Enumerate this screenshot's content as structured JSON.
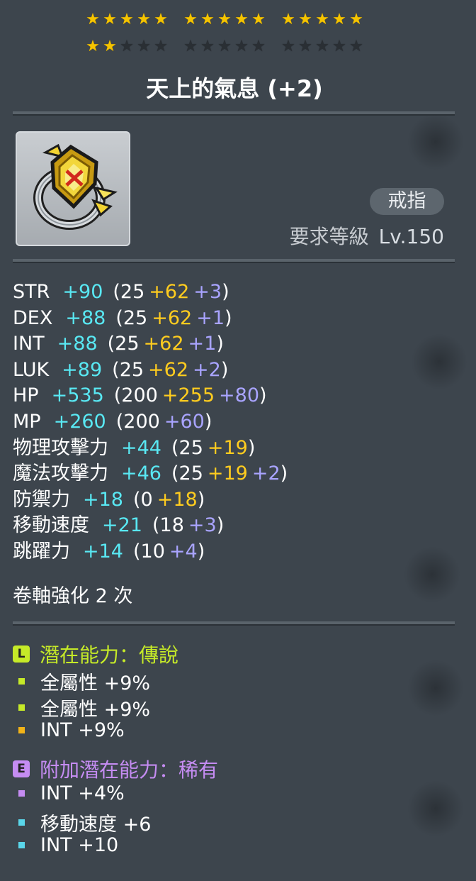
{
  "stars": {
    "filled": 17,
    "total": 30,
    "group_size": 5,
    "row1_groups": 3,
    "row2_groups": 3,
    "on_color": "#f5c400",
    "off_color": "#2a2f34"
  },
  "item": {
    "name": "天上的氣息 (+2)",
    "category": "戒指",
    "req_level_label": "要求等級",
    "req_level_value": "Lv.150",
    "icon": "gold-ring-icon"
  },
  "stats": [
    {
      "name": "STR",
      "total": "+90",
      "open": "(25",
      "parts": [
        {
          "v": "+62",
          "c": "yellow"
        },
        {
          "v": "+3",
          "c": "purple"
        }
      ],
      "close": ")"
    },
    {
      "name": "DEX",
      "total": "+88",
      "open": "(25",
      "parts": [
        {
          "v": "+62",
          "c": "yellow"
        },
        {
          "v": "+1",
          "c": "purple"
        }
      ],
      "close": ")"
    },
    {
      "name": "INT",
      "total": "+88",
      "open": "(25",
      "parts": [
        {
          "v": "+62",
          "c": "yellow"
        },
        {
          "v": "+1",
          "c": "purple"
        }
      ],
      "close": ")"
    },
    {
      "name": "LUK",
      "total": "+89",
      "open": "(25",
      "parts": [
        {
          "v": "+62",
          "c": "yellow"
        },
        {
          "v": "+2",
          "c": "purple"
        }
      ],
      "close": ")"
    },
    {
      "name": "HP",
      "total": "+535",
      "open": "(200",
      "parts": [
        {
          "v": "+255",
          "c": "yellow"
        },
        {
          "v": "+80",
          "c": "purple"
        }
      ],
      "close": ")"
    },
    {
      "name": "MP",
      "total": "+260",
      "open": "(200",
      "parts": [
        {
          "v": "+60",
          "c": "purple"
        }
      ],
      "close": ")"
    },
    {
      "name": "物理攻擊力",
      "total": "+44",
      "open": "(25",
      "parts": [
        {
          "v": "+19",
          "c": "yellow"
        }
      ],
      "close": ")"
    },
    {
      "name": "魔法攻擊力",
      "total": "+46",
      "open": "(25",
      "parts": [
        {
          "v": "+19",
          "c": "yellow"
        },
        {
          "v": "+2",
          "c": "purple"
        }
      ],
      "close": ")"
    },
    {
      "name": "防禦力",
      "total": "+18",
      "open": "(0",
      "parts": [
        {
          "v": "+18",
          "c": "yellow"
        }
      ],
      "close": ")"
    },
    {
      "name": "移動速度",
      "total": "+21",
      "open": "(18",
      "parts": [
        {
          "v": "+3",
          "c": "purple"
        }
      ],
      "close": ")"
    },
    {
      "name": "跳躍力",
      "total": "+14",
      "open": "(10",
      "parts": [
        {
          "v": "+4",
          "c": "purple"
        }
      ],
      "close": ")"
    }
  ],
  "scroll_upgrades": "卷軸強化 2 次",
  "potential": {
    "icon_letter": "L",
    "header": "潛在能力：傳說",
    "color": "#c6ea28",
    "lines": [
      {
        "text": "全屬性 +9%",
        "bullet": "#c6ea28"
      },
      {
        "text": "全屬性 +9%",
        "bullet": "#c6ea28"
      },
      {
        "text": "INT +9%",
        "bullet": "#f2b318"
      }
    ]
  },
  "additional_potential": {
    "icon_letter": "E",
    "header": "附加潛在能力：稀有",
    "color": "#c58cf2",
    "lines": [
      {
        "text": "INT +4%",
        "bullet": "#c58cf2"
      },
      {
        "text": "移動速度 +6",
        "bullet": "#5ad6ea"
      },
      {
        "text": "INT +10",
        "bullet": "#5ad6ea"
      }
    ]
  }
}
